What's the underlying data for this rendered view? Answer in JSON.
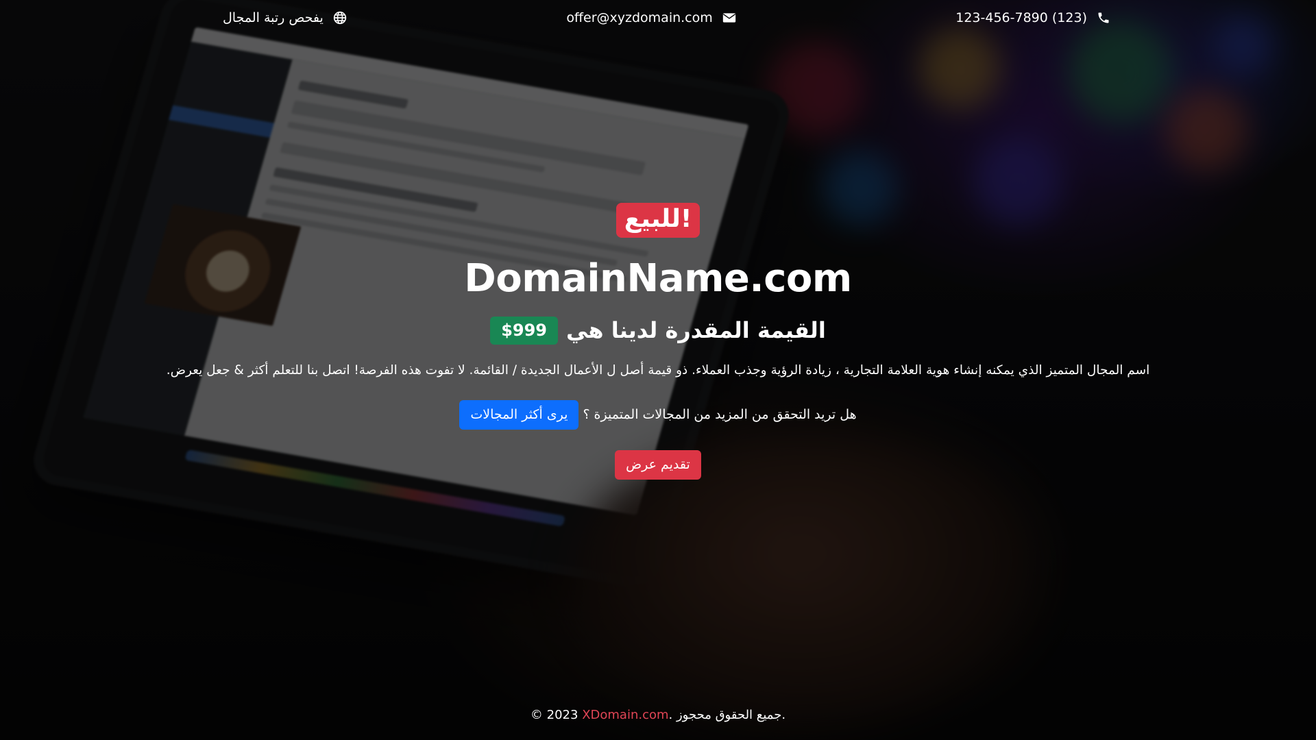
{
  "topbar": {
    "ranking_label": "يفحص رتبة المجال",
    "ranking_icon": "globe-icon",
    "email": "offer@xyzdomain.com",
    "email_icon": "envelope-icon",
    "phone": "123-456-7890 (123)",
    "phone_icon": "phone-icon"
  },
  "hero": {
    "sale_badge": "للبيع!",
    "domain_name": "DomainName.com",
    "value_text": "القيمة المقدرة لدينا هي",
    "price": "$999",
    "description": "اسم المجال المتميز الذي يمكنه إنشاء هوية العلامة التجارية ، زيادة الرؤية وجذب العملاء. ذو قيمة أصل ل الأعمال الجديدة / القائمة. لا تفوت هذه الفرصة! اتصل بنا للتعلم أكثر & جعل يعرض.",
    "more_question": "هل تريد التحقق من المزيد من المجالات المتميزة ؟",
    "more_button": "يرى أكثر المجالات",
    "offer_button": "تقديم عرض"
  },
  "footer": {
    "prefix": "© 2023",
    "link": "XDomain.com",
    "suffix": ". جميع الحقوق محجوز."
  },
  "colors": {
    "red": "#dc3545",
    "green": "#198754",
    "blue": "#0d6efd",
    "link_red": "#e04555"
  }
}
